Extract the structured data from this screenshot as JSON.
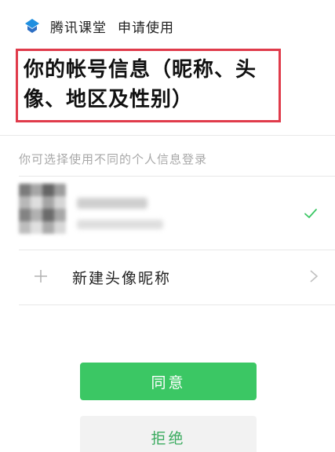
{
  "header": {
    "app_name": "腾讯课堂",
    "request_text": "申请使用",
    "logo_icon": "tencent-classroom-logo-icon"
  },
  "permission": {
    "title": "你的帐号信息（昵称、头像、地区及性别）",
    "highlight_color": "#e03b4b"
  },
  "hint": "你可选择使用不同的个人信息登录",
  "account": {
    "avatar_icon": "blurred-avatar",
    "selected": true,
    "check_icon": "check-icon"
  },
  "new_profile": {
    "label": "新建头像昵称",
    "plus_icon": "plus-icon",
    "chevron_icon": "chevron-right-icon"
  },
  "buttons": {
    "agree": "同意",
    "reject": "拒绝"
  },
  "colors": {
    "accent_green": "#3bc764",
    "reject_text": "#3bab5f",
    "reject_bg": "#f2f2f2"
  }
}
